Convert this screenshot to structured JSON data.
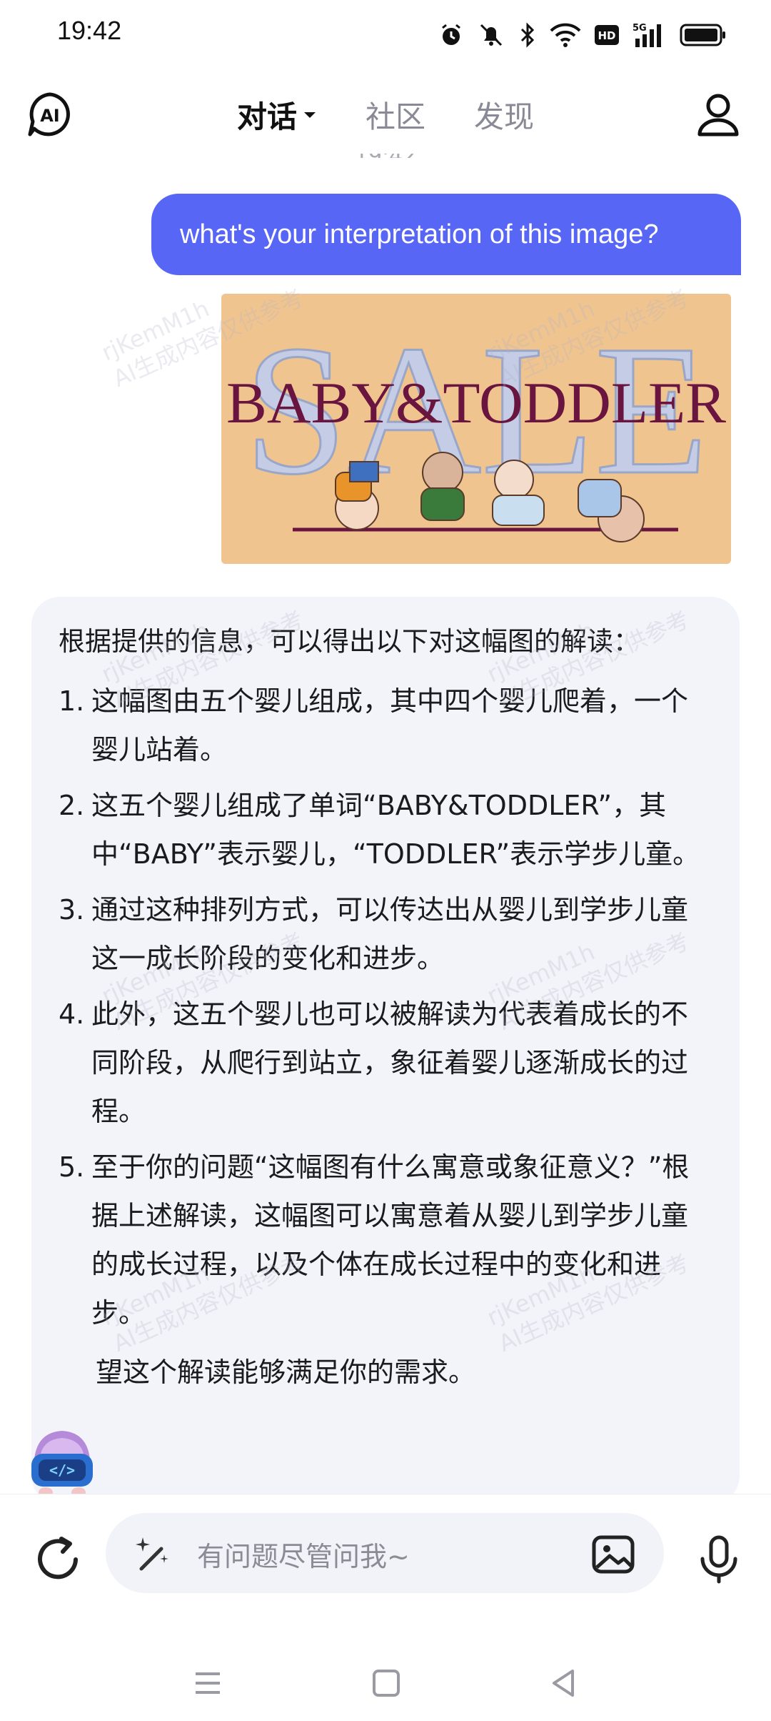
{
  "status_bar": {
    "time": "19:42"
  },
  "header": {
    "tabs": [
      {
        "label": "对话",
        "active": true
      },
      {
        "label": "社区",
        "active": false
      },
      {
        "label": "发现",
        "active": false
      }
    ]
  },
  "chat": {
    "user_message": "what's your interpretation of this image?",
    "image_text": {
      "top": "SALE",
      "main": "BABY&TODDLER"
    },
    "ai_response": {
      "intro": "根据提供的信息，可以得出以下对这幅图的解读：",
      "items": [
        {
          "num": "1.",
          "text": "这幅图由五个婴儿组成，其中四个婴儿爬着，一个婴儿站着。"
        },
        {
          "num": "2.",
          "text": "这五个婴儿组成了单词“BABY&TODDLER”，其中“BABY”表示婴儿，“TODDLER”表示学步儿童。"
        },
        {
          "num": "3.",
          "text": "通过这种排列方式，可以传达出从婴儿到学步儿童这一成长阶段的变化和进步。"
        },
        {
          "num": "4.",
          "text": "此外，这五个婴儿也可以被解读为代表着成长的不同阶段，从爬行到站立，象征着婴儿逐渐成长的过程。"
        },
        {
          "num": "5.",
          "text": "至于你的问题“这幅图有什么寓意或象征意义？”根据上述解读，这幅图可以寓意着从婴儿到学步儿童的成长过程，以及个体在成长过程中的变化和进步。"
        }
      ],
      "closing": "望这个解读能够满足你的需求。"
    },
    "watermark": {
      "line1": "rjKemM1h",
      "line2": "AI生成内容仅供参考"
    }
  },
  "input": {
    "placeholder": "有问题尽管问我~"
  },
  "colors": {
    "accent": "#5866f5",
    "ai_bubble_bg": "#f3f4f9",
    "image_bg": "#f0c48e"
  },
  "icons": {
    "left": "refresh-icon",
    "input_left": "magic-wand-icon",
    "input_right": "image-upload-icon",
    "right": "microphone-icon"
  }
}
